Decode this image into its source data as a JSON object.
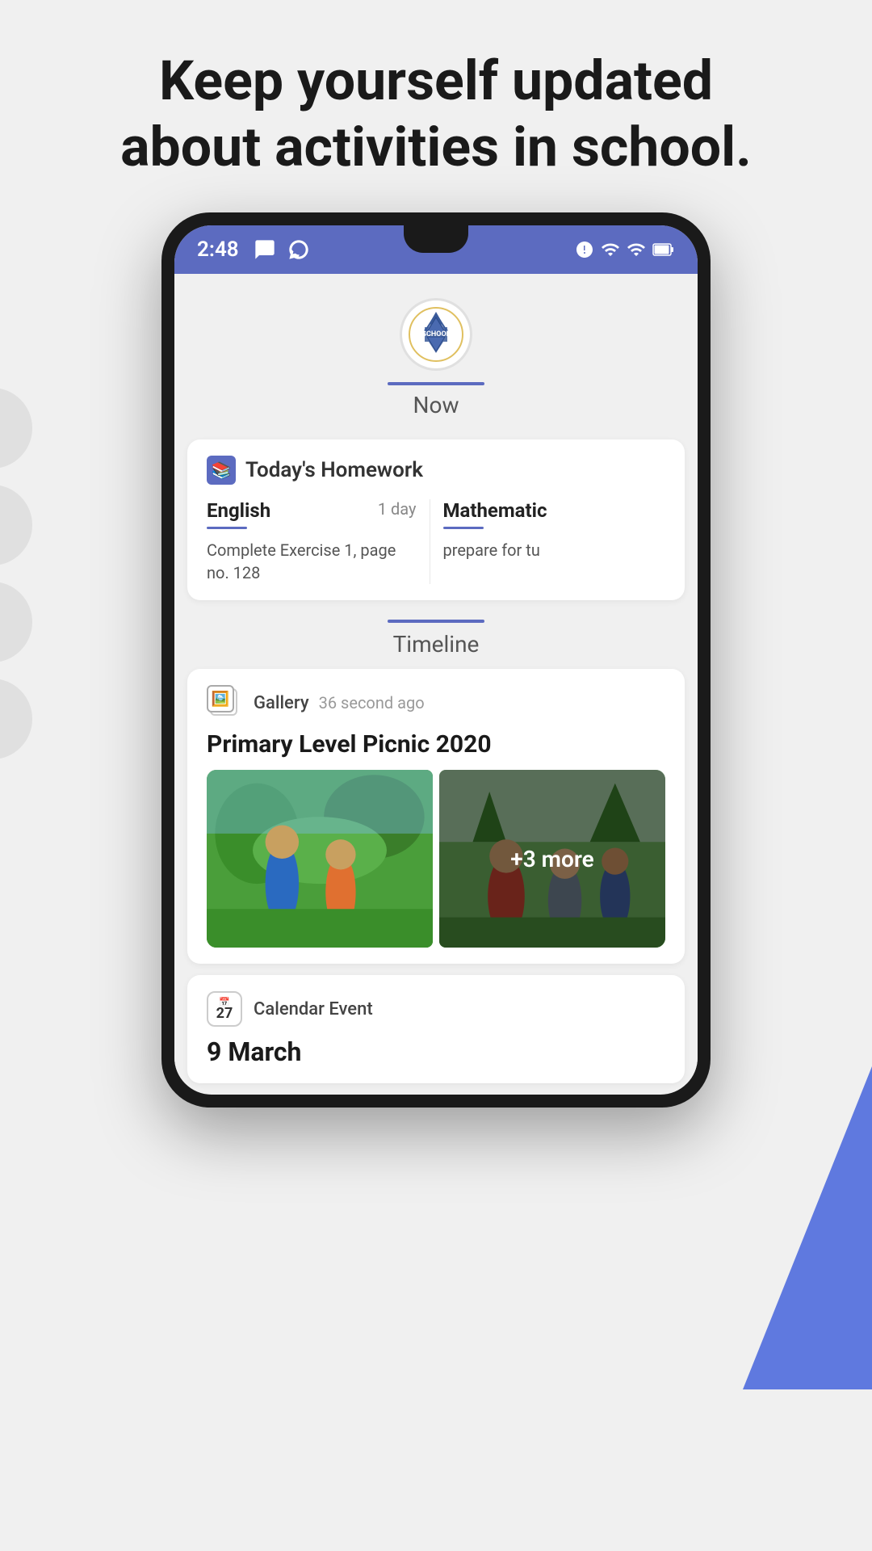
{
  "page": {
    "heading_line1": "Keep yourself updated",
    "heading_line2": "about activities in school."
  },
  "statusBar": {
    "time": "2:48",
    "icons_left": [
      "message-icon",
      "whatsapp-icon"
    ],
    "icons_right": [
      "alarm-icon",
      "wifi-icon",
      "signal-icon",
      "battery-icon"
    ]
  },
  "schoolHeader": {
    "tab_now_label": "Now",
    "logo_alt": "School Logo"
  },
  "homeworkSection": {
    "card_title": "Today's Homework",
    "subjects": [
      {
        "name": "English",
        "days_label": "1 day",
        "task": "Complete Exercise 1, page no. 128"
      },
      {
        "name": "Mathematic",
        "days_label": "",
        "task": "prepare for tu"
      }
    ]
  },
  "timelineSection": {
    "tab_label": "Timeline",
    "gallery_post": {
      "type": "Gallery",
      "time": "36 second ago",
      "title": "Primary Level Picnic 2020",
      "more_count": "+3 more"
    },
    "calendar_post": {
      "type": "Calendar Event",
      "icon_number": "27",
      "date": "9 March"
    }
  }
}
